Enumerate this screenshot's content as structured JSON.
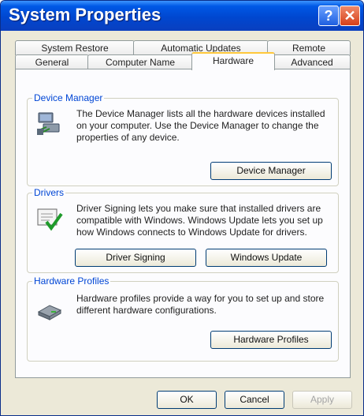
{
  "window": {
    "title": "System Properties",
    "help_glyph": "?",
    "close_glyph": "✕"
  },
  "tabs_row1": [
    "System Restore",
    "Automatic Updates",
    "Remote"
  ],
  "tabs_row2": [
    "General",
    "Computer Name",
    "Hardware",
    "Advanced"
  ],
  "active_tab": "Hardware",
  "device_manager": {
    "title": "Device Manager",
    "description": "The Device Manager lists all the hardware devices installed on your computer. Use the Device Manager to change the properties of any device.",
    "button": "Device Manager"
  },
  "drivers": {
    "title": "Drivers",
    "description": "Driver Signing lets you make sure that installed drivers are compatible with Windows. Windows Update lets you set up how Windows connects to Windows Update for drivers.",
    "button_signing": "Driver Signing",
    "button_update": "Windows Update"
  },
  "hardware_profiles": {
    "title": "Hardware Profiles",
    "description": "Hardware profiles provide a way for you to set up and store different hardware configurations.",
    "button": "Hardware Profiles"
  },
  "footer": {
    "ok": "OK",
    "cancel": "Cancel",
    "apply": "Apply"
  },
  "colors": {
    "title_bar": "#0047d0",
    "group_title": "#0046d5",
    "active_tab_accent": "#ffc83c"
  }
}
